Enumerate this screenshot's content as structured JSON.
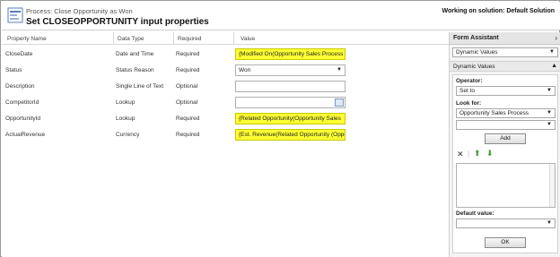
{
  "header": {
    "process_label": "Process: Close Opportunity as Won",
    "title": "Set CLOSEOPPORTUNITY input properties",
    "solution_label": "Working on solution: Default Solution"
  },
  "grid": {
    "columns": [
      "Property Name",
      "Data Type",
      "Required",
      "Value"
    ],
    "rows": [
      {
        "name": "CloseDate",
        "type": "Date and Time",
        "required": "Required",
        "value": "{Modified On(Opportunity Sales Process",
        "highlight": true,
        "control": "text"
      },
      {
        "name": "Status",
        "type": "Status Reason",
        "required": "Required",
        "value": "Won",
        "highlight": false,
        "control": "select"
      },
      {
        "name": "Description",
        "type": "Single Line of Text",
        "required": "Optional",
        "value": "",
        "highlight": false,
        "control": "text"
      },
      {
        "name": "CompetitorId",
        "type": "Lookup",
        "required": "Optional",
        "value": "",
        "highlight": false,
        "control": "lookup"
      },
      {
        "name": "OpportunityId",
        "type": "Lookup",
        "required": "Required",
        "value": "{Related Opportunity(Opportunity Sales",
        "highlight": true,
        "control": "text"
      },
      {
        "name": "ActualRevenue",
        "type": "Currency",
        "required": "Required",
        "value": "{Est. Revenue(Related Opportunity (Oppo",
        "highlight": true,
        "control": "text"
      }
    ]
  },
  "form_assistant": {
    "title": "Form Assistant",
    "collapse_icon": "chevron-right-icon",
    "top_select": "Dynamic Values",
    "section_label": "Dynamic Values",
    "section_icon": "caret-up-icon",
    "operator_label": "Operator:",
    "operator_value": "Set to",
    "look_for_label": "Look for:",
    "look_for_value": "Opportunity Sales Process",
    "look_for_attr_value": "",
    "add_label": "Add",
    "delete_icon": "delete-x-icon",
    "move_up_icon": "arrow-up-icon",
    "move_down_icon": "arrow-down-icon",
    "default_value_label": "Default value:",
    "default_value": "",
    "ok_label": "OK"
  }
}
